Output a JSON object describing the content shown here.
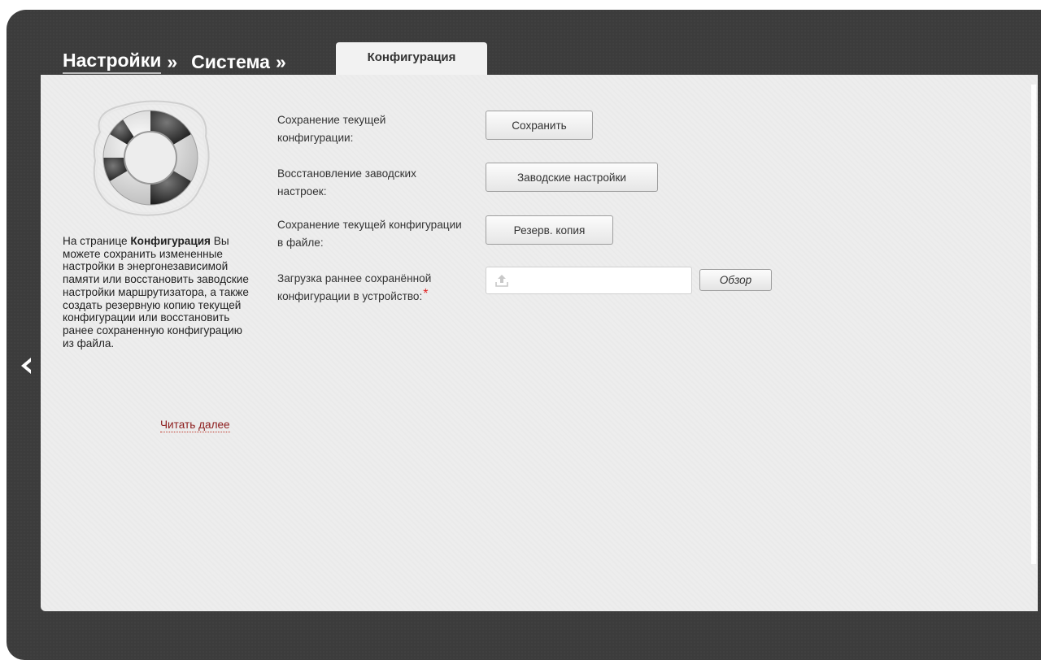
{
  "breadcrumb": {
    "items": [
      {
        "label": "Настройки",
        "sep": "»"
      },
      {
        "label": "Система",
        "sep": "»"
      }
    ],
    "active_tab": "Конфигурация"
  },
  "sidebar": {
    "description_prefix": "На странице ",
    "description_bold": "Конфигурация",
    "description_rest": " Вы можете сохранить измененные настройки в энергонезависимой памяти или восстановить заводские настройки маршрутизатора, а также создать резервную копию текущей конфигурации или восстановить ранее сохраненную конфигурацию из файла.",
    "read_more": "Читать далее",
    "image_icon": "lifebuoy-icon"
  },
  "rows": [
    {
      "label": "Сохранение текущей конфигурации:",
      "button": "Сохранить"
    },
    {
      "label": "Восстановление заводских настроек:",
      "button": "Заводские настройки"
    },
    {
      "label": "Сохранение текущей конфигурации в файле:",
      "button": "Резерв. копия"
    },
    {
      "label": "Загрузка раннее сохранённой конфигурации в устройство:",
      "required_mark": "*",
      "file_value": "",
      "browse": "Обзор"
    }
  ],
  "colors": {
    "frame": "#3c3c3c",
    "panel": "#ededed",
    "link": "#8b1a1a",
    "required": "#e02020"
  }
}
